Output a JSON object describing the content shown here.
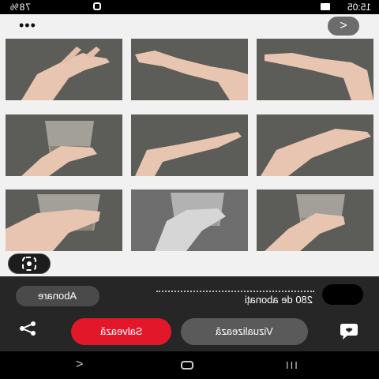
{
  "status_bar": {
    "time": "15:05",
    "battery": "78%"
  },
  "top_bar": {
    "menu_label": "•••",
    "next_label": ">"
  },
  "gallery": {
    "tiles": [
      {
        "label": "open hand reaching"
      },
      {
        "label": "hand palm up"
      },
      {
        "label": "hand palm up flat"
      },
      {
        "label": "hand holding glass"
      },
      {
        "label": "hand palm up open"
      },
      {
        "label": "hand cupped"
      },
      {
        "label": "hand gripping glass"
      },
      {
        "label": "hand holding glass grayscale"
      },
      {
        "label": "hand holding glass side"
      }
    ]
  },
  "profile": {
    "followers_text": "280 de abonați",
    "subscribe_label": "Abonare"
  },
  "actions": {
    "view_label": "Vizualizează",
    "save_label": "Salvează"
  },
  "colors": {
    "accent_red": "#e3172a",
    "dark_panel": "#262626",
    "tile_bg": "#5a5a56"
  },
  "nav": {
    "back": "<",
    "recent": "III"
  }
}
